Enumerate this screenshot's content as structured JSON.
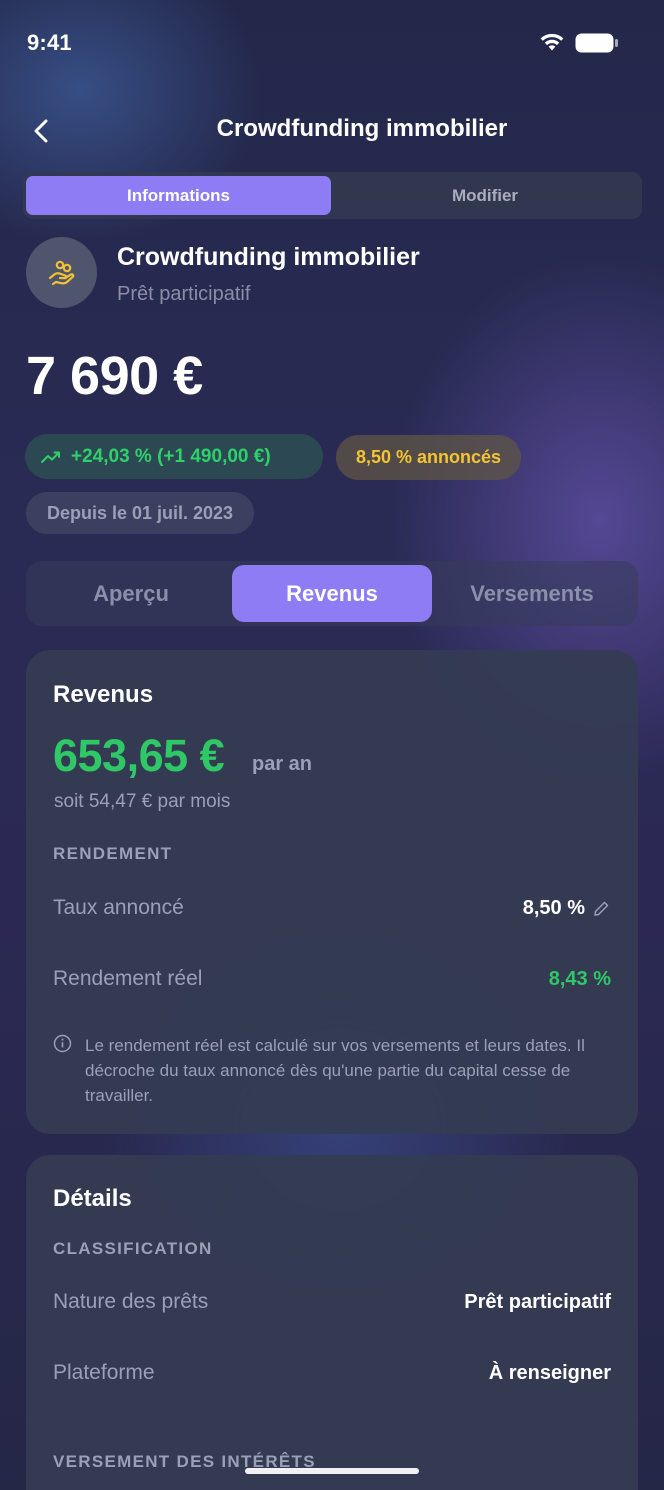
{
  "status_bar": {
    "time": "9:41"
  },
  "nav": {
    "title": "Crowdfunding immobilier"
  },
  "top_segment": {
    "active": "Informations",
    "inactive": "Modifier"
  },
  "asset": {
    "name": "Crowdfunding immobilier",
    "type": "Prêt participatif",
    "value": "7 690 €",
    "performance": "+24,03 % (+1 490,00 €)",
    "announced_rate": "8,50 % annoncés",
    "since": "Depuis le 01 juil. 2023"
  },
  "tabs": [
    "Aperçu",
    "Revenus",
    "Versements"
  ],
  "revenus": {
    "title": "Revenus",
    "annual_amount": "653,65 €",
    "per_year": "par an",
    "monthly": "soit 54,47 € par mois",
    "section": "RENDEMENT",
    "rows": [
      {
        "label": "Taux annoncé",
        "value": "8,50 %"
      },
      {
        "label": "Rendement réel",
        "value": "8,43 %"
      }
    ],
    "note": "Le rendement réel est calculé sur vos versements et leurs dates. Il décroche du taux annoncé dès qu'une partie du capital cesse de travailler."
  },
  "details": {
    "title": "Détails",
    "section_classification": "CLASSIFICATION",
    "rows": [
      {
        "label": "Nature des prêts",
        "value": "Prêt participatif"
      },
      {
        "label": "Plateforme",
        "value": "À renseigner"
      }
    ],
    "section_interests": "VERSEMENT DES INTÉRÊTS"
  },
  "colors": {
    "accent": "#8d7cf4",
    "positive": "#2ec866",
    "rate_chip": "#f4c433"
  }
}
